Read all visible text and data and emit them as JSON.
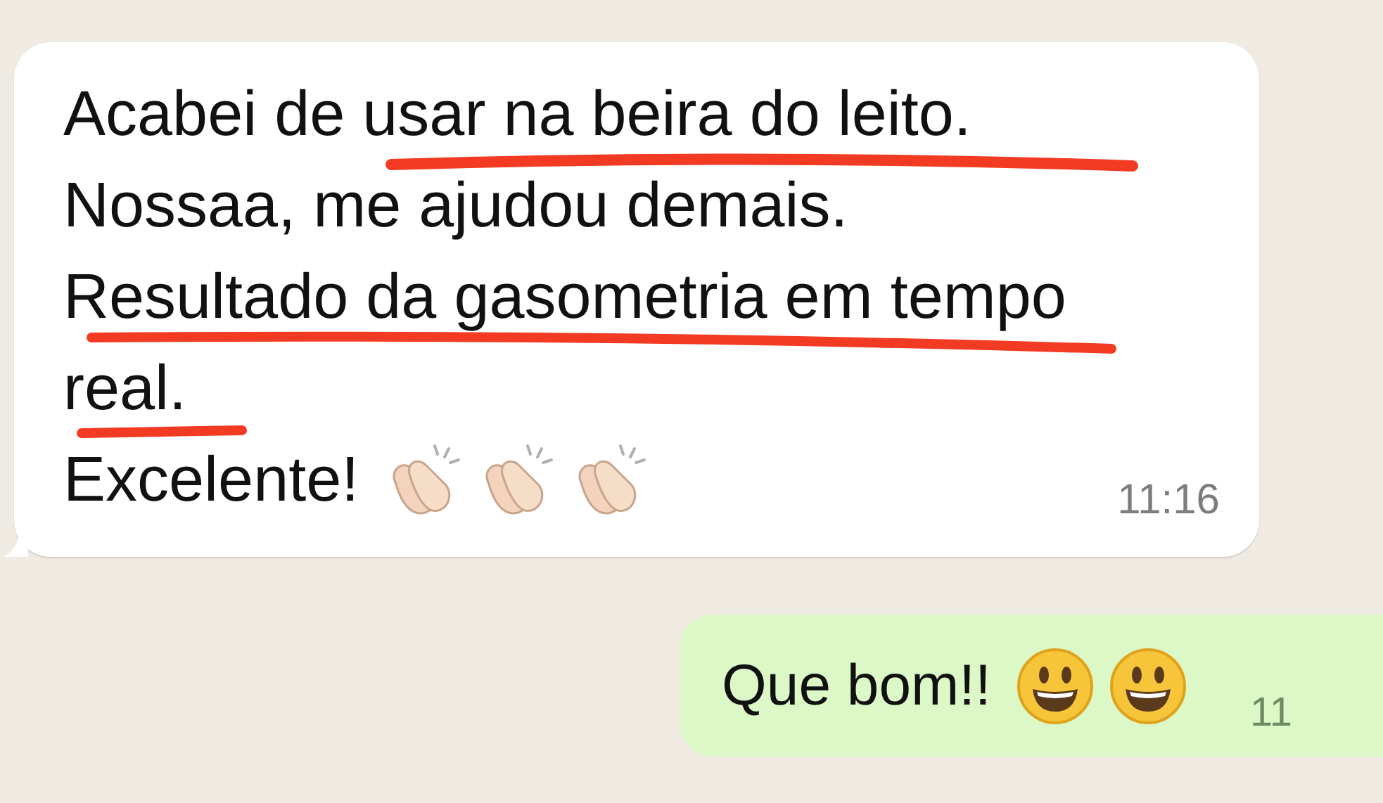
{
  "messages": [
    {
      "kind": "incoming",
      "lines": [
        "Acabei de usar na beira do leito.",
        "Nossaa, me ajudou demais.",
        "Resultado da gasometria em tempo",
        "real.",
        "Excelente!"
      ],
      "emojis": [
        {
          "kind": "clap"
        },
        {
          "kind": "clap"
        },
        {
          "kind": "clap"
        }
      ],
      "time": "11:16"
    },
    {
      "kind": "outgoing",
      "lines": [
        "Que bom!!"
      ],
      "emojis": [
        {
          "kind": "smiley"
        },
        {
          "kind": "smiley"
        }
      ],
      "time": "11"
    }
  ]
}
